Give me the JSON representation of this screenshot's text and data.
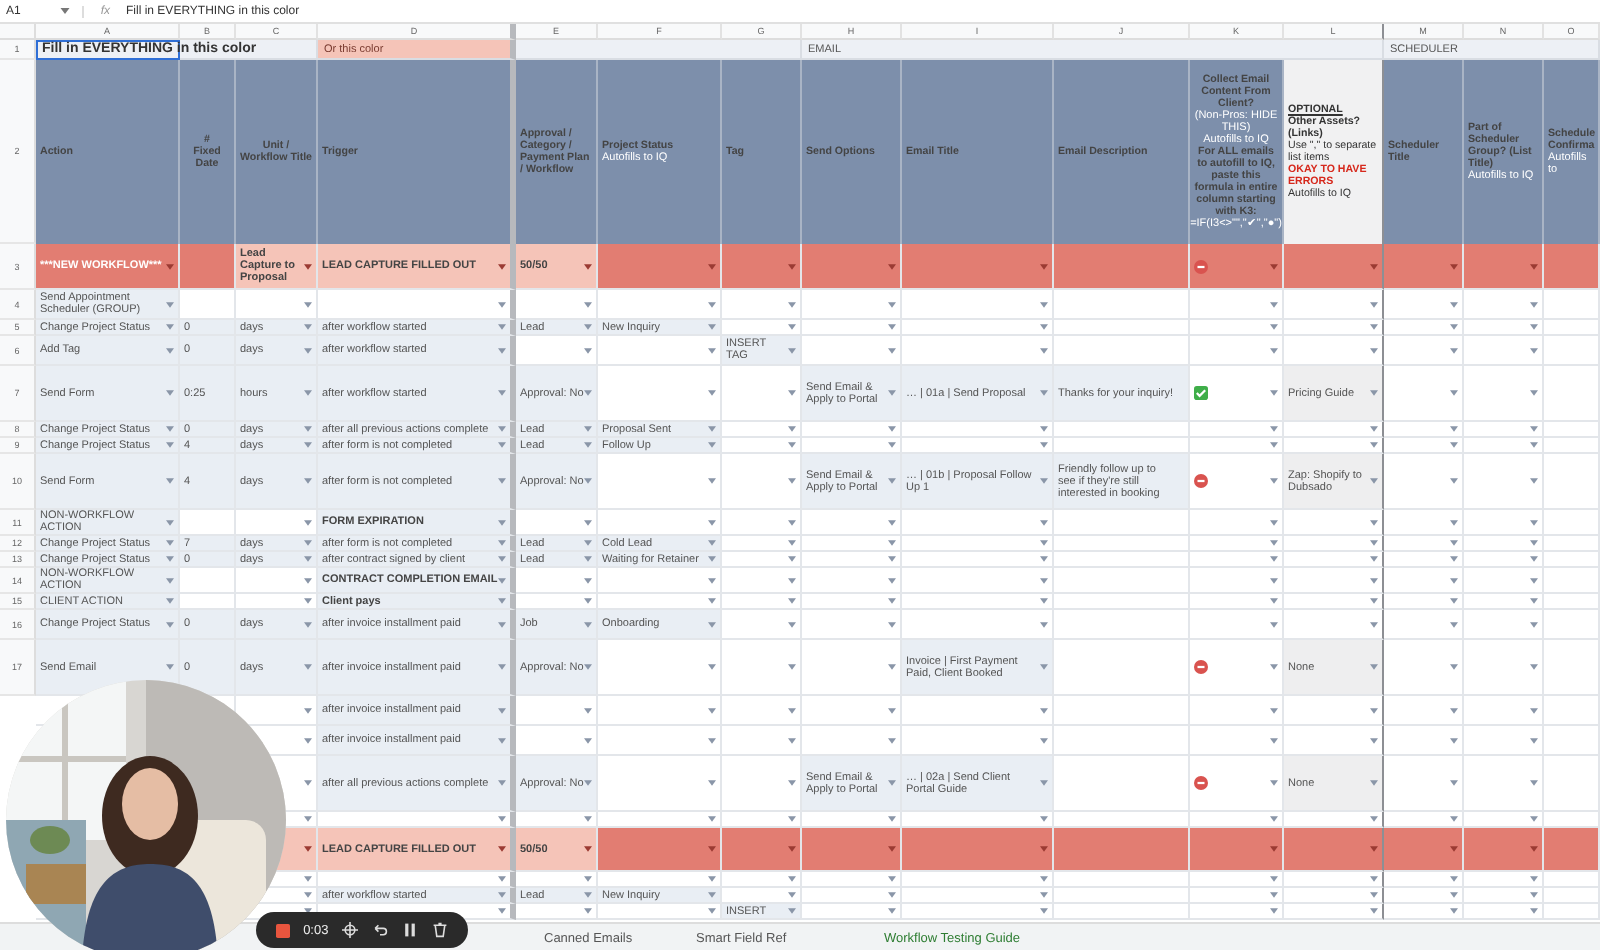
{
  "formula_bar": {
    "cell": "A1",
    "function_label": "fx",
    "formula": "Fill in EVERYTHING in this color"
  },
  "columns": [
    {
      "letter": "A",
      "dropdown": true
    },
    {
      "letter": "B",
      "dropdown": false
    },
    {
      "letter": "C",
      "dropdown": true
    },
    {
      "letter": "D",
      "dropdown": true
    },
    {
      "letter": "E",
      "dropdown": true
    },
    {
      "letter": "F",
      "dropdown": true
    },
    {
      "letter": "G",
      "dropdown": true
    },
    {
      "letter": "H",
      "dropdown": true
    },
    {
      "letter": "I",
      "dropdown": true
    },
    {
      "letter": "J",
      "dropdown": false
    },
    {
      "letter": "K",
      "dropdown": true
    },
    {
      "letter": "L",
      "dropdown": true
    },
    {
      "letter": "M",
      "dropdown": true
    },
    {
      "letter": "N",
      "dropdown": true
    },
    {
      "letter": "O",
      "dropdown": false
    }
  ],
  "section_row": {
    "number": "1",
    "cells": {
      "A": {
        "text": "Fill in EVERYTHING in this color",
        "selected": true
      },
      "D": {
        "text": "Or this color",
        "selected": false
      },
      "H": {
        "text": "EMAIL",
        "selected": false
      },
      "M": {
        "text": "SCHEDULER",
        "selected": false
      }
    }
  },
  "header_row": {
    "number": "2",
    "cells": [
      [
        {
          "text": "Action",
          "kind": "title"
        }
      ],
      [
        {
          "text": "#",
          "kind": "title"
        },
        {
          "text": "Fixed Date",
          "kind": "title"
        }
      ],
      [
        {
          "text": "Unit /",
          "kind": "title"
        },
        {
          "text": "Workflow Title",
          "kind": "title"
        }
      ],
      [
        {
          "text": "Trigger",
          "kind": "title"
        }
      ],
      [
        {
          "text": "Approval / Category / Payment Plan / Workflow",
          "kind": "title"
        }
      ],
      [
        {
          "text": "Project Status",
          "kind": "title"
        },
        {
          "text": "Autofills to IQ",
          "kind": "note"
        }
      ],
      [
        {
          "text": "Tag",
          "kind": "title"
        }
      ],
      [
        {
          "text": "Send Options",
          "kind": "title"
        }
      ],
      [
        {
          "text": "Email Title",
          "kind": "title"
        }
      ],
      [
        {
          "text": "Email Description",
          "kind": "title"
        }
      ],
      [
        {
          "text": "Collect Email Content From Client?",
          "kind": "title"
        },
        {
          "text": "(Non-Pros: HIDE THIS)",
          "kind": "note"
        },
        {
          "text": "Autofills to IQ",
          "kind": "note"
        },
        {
          "text": "For ALL emails to autofill to IQ, paste this formula in entire column starting with K3:",
          "kind": "title"
        },
        {
          "text": "=IF(I3<>\"\",\"✔\",\"●\")",
          "kind": "note"
        }
      ],
      [
        {
          "text": "OPTIONAL",
          "kind": "heading"
        },
        {
          "text": "Other Assets? (Links)",
          "kind": "subheading"
        },
        {
          "text": "Use \",\" to separate list items",
          "kind": "body"
        },
        {
          "text": "OKAY TO HAVE ERRORS",
          "kind": "warning"
        },
        {
          "text": "Autofills to IQ",
          "kind": "body"
        }
      ],
      [
        {
          "text": "Scheduler Title",
          "kind": "title"
        }
      ],
      [
        {
          "text": "Part of Scheduler Group? (List Title)",
          "kind": "title"
        },
        {
          "text": "Autofills to IQ",
          "kind": "note"
        }
      ],
      [
        {
          "text": "Schedule",
          "kind": "title"
        },
        {
          "text": "Confirma",
          "kind": "title"
        },
        {
          "text": "Autofills to",
          "kind": "note"
        }
      ]
    ]
  },
  "rows": [
    {
      "number": "3",
      "kind": "workflow",
      "client_content": false,
      "cells": {
        "A": "***NEW WORKFLOW***",
        "C": "Lead Capture to Proposal",
        "D": "LEAD CAPTURE FILLED OUT",
        "E": "50/50"
      }
    },
    {
      "number": "4",
      "kind": "step",
      "cells": {
        "A": "Send Appointment Scheduler (GROUP)"
      }
    },
    {
      "number": "5",
      "kind": "step",
      "cells": {
        "A": "Change Project Status",
        "B": "0",
        "C": "days",
        "D": "after workflow started",
        "E": "Lead",
        "F": "New Inquiry"
      }
    },
    {
      "number": "6",
      "kind": "step",
      "cells": {
        "A": "Add Tag",
        "B": "0",
        "C": "days",
        "D": "after workflow started",
        "G": "INSERT TAG"
      }
    },
    {
      "number": "7",
      "kind": "step",
      "client_content": true,
      "cells": {
        "A": "Send Form",
        "B": "0:25",
        "C": "hours",
        "D": "after workflow started",
        "E": "Approval: No",
        "H": "Send Email & Apply to Portal",
        "I": "… | 01a | Send Proposal",
        "J": "Thanks for your inquiry!",
        "L": "Pricing Guide"
      }
    },
    {
      "number": "8",
      "kind": "step",
      "cells": {
        "A": "Change Project Status",
        "B": "0",
        "C": "days",
        "D": "after all previous actions complete",
        "E": "Lead",
        "F": "Proposal Sent"
      }
    },
    {
      "number": "9",
      "kind": "step",
      "cells": {
        "A": "Change Project Status",
        "B": "4",
        "C": "days",
        "D": "after form is not completed",
        "E": "Lead",
        "F": "Follow Up"
      }
    },
    {
      "number": "10",
      "kind": "step",
      "client_content": false,
      "cells": {
        "A": "Send Form",
        "B": "4",
        "C": "days",
        "D": "after form is not completed",
        "E": "Approval: No",
        "H": "Send Email & Apply to Portal",
        "I": "… | 01b | Proposal Follow Up 1",
        "J": "Friendly follow up to see if they're still interested in booking",
        "L": "Zap: Shopify to Dubsado"
      }
    },
    {
      "number": "11",
      "kind": "section",
      "cells": {
        "A": "NON-WORKFLOW ACTION",
        "D": "FORM EXPIRATION"
      }
    },
    {
      "number": "12",
      "kind": "step",
      "cells": {
        "A": "Change Project Status",
        "B": "7",
        "C": "days",
        "D": "after form is not completed",
        "E": "Lead",
        "F": "Cold Lead"
      }
    },
    {
      "number": "13",
      "kind": "step",
      "cells": {
        "A": "Change Project Status",
        "B": "0",
        "C": "days",
        "D": "after contract signed by client",
        "E": "Lead",
        "F": "Waiting for Retainer"
      }
    },
    {
      "number": "14",
      "kind": "section",
      "cells": {
        "A": "NON-WORKFLOW ACTION",
        "D": "CONTRACT COMPLETION EMAIL"
      }
    },
    {
      "number": "15",
      "kind": "section",
      "cells": {
        "A": "CLIENT ACTION",
        "D": "Client pays"
      }
    },
    {
      "number": "16",
      "kind": "step",
      "cells": {
        "A": "Change Project Status",
        "B": "0",
        "C": "days",
        "D": "after invoice installment paid",
        "E": "Job",
        "F": "Onboarding"
      }
    },
    {
      "number": "17",
      "kind": "step",
      "client_content": false,
      "cells": {
        "A": "Send Email",
        "B": "0",
        "C": "days",
        "D": "after invoice installment paid",
        "E": "Approval: No",
        "I": "Invoice | First Payment Paid, Client Booked",
        "L": "None"
      }
    },
    {
      "kind": "step",
      "cells": {
        "D": "after invoice installment paid"
      }
    },
    {
      "kind": "step",
      "cells": {
        "D": "after invoice installment paid"
      }
    },
    {
      "kind": "step",
      "client_content": false,
      "cells": {
        "D": "after all previous actions complete",
        "E": "Approval: No",
        "H": "Send Email & Apply to Portal",
        "I": "… | 02a | Send Client Portal Guide",
        "L": "None"
      }
    },
    {
      "kind": "step"
    },
    {
      "kind": "workflow",
      "cells": {
        "D": "LEAD CAPTURE FILLED OUT",
        "E": "50/50"
      }
    },
    {
      "kind": "step"
    },
    {
      "kind": "step",
      "cells": {
        "D": "after workflow started",
        "E": "Lead",
        "F": "New Inquiry"
      }
    },
    {
      "kind": "step",
      "cells": {
        "G": "INSERT"
      }
    }
  ],
  "sheet_tabs": [
    "Canned Emails",
    "Smart Field Ref",
    "Workflow Testing Guide"
  ],
  "recorder": {
    "time": "0:03"
  }
}
